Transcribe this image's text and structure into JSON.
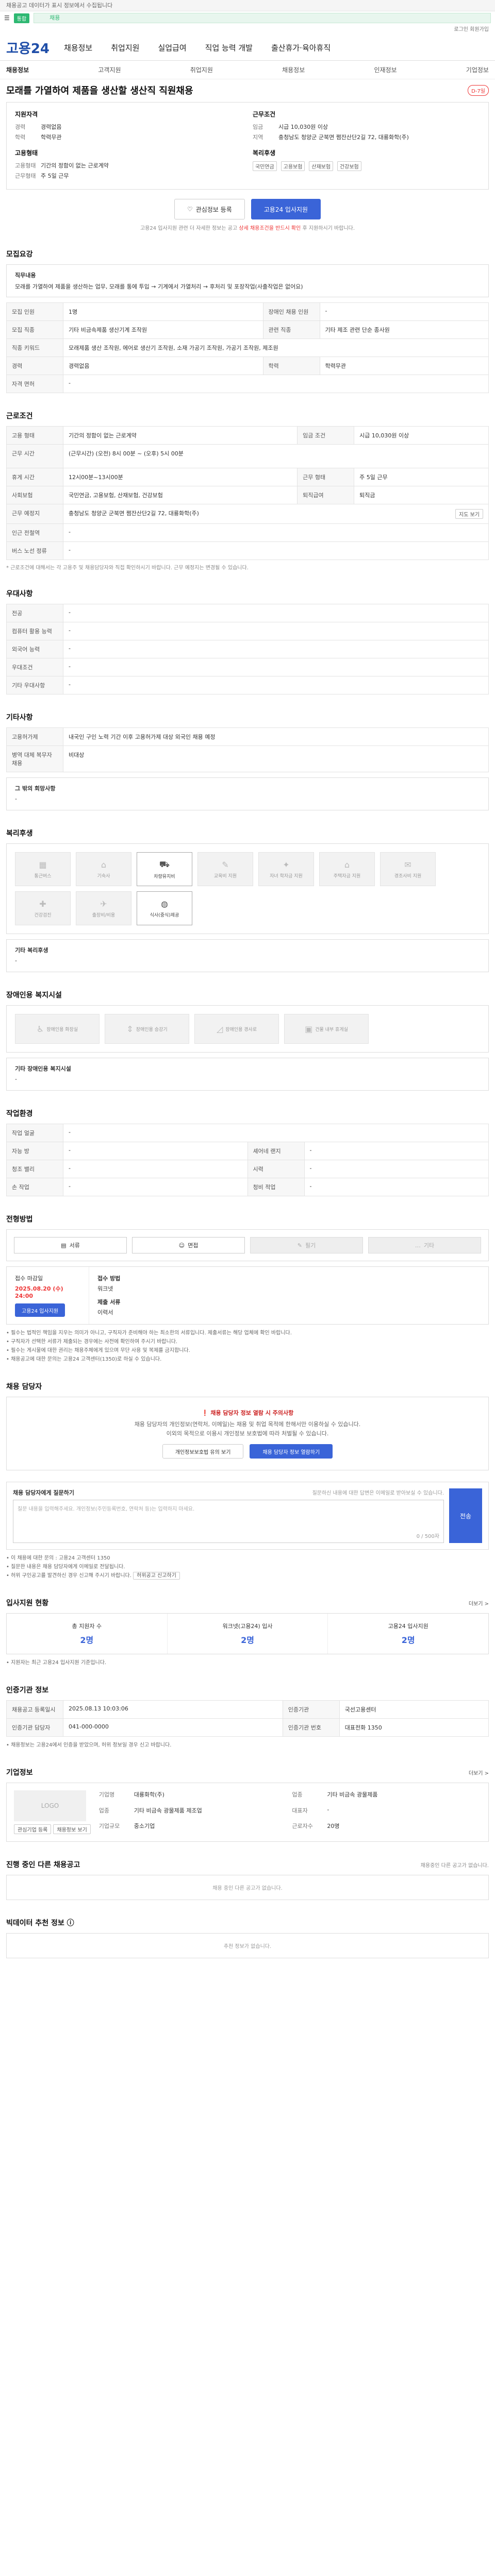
{
  "top_notice": "채용공고 데이터가 표시 정보에서 수집됩니다",
  "search": {
    "tag": "통합",
    "value": "채용"
  },
  "util_links": "로그인  회원가입",
  "logo": "고용24",
  "gnb": [
    "채용정보",
    "취업지원",
    "실업급여",
    "직업 능력 개발",
    "출산휴가·육아휴직"
  ],
  "subnav": [
    "채용정보",
    "고객지원",
    "취업지원",
    "채용정보",
    "인재정보",
    "기업정보"
  ],
  "job": {
    "title": "모래를 가열하여 제품을 생산할 생산직 직원채용",
    "dday": "D-7일",
    "left_head": "지원자격",
    "left": [
      {
        "k": "경력",
        "v": "경력없음"
      },
      {
        "k": "학력",
        "v": "학력무관"
      }
    ],
    "left2_head": "고용형태",
    "left2": [
      {
        "k": "고용형태",
        "v": "기간의 정함이 없는 근로계약"
      },
      {
        "k": "근무형태",
        "v": "주 5일 근무"
      }
    ],
    "right_head": "근무조건",
    "right": [
      {
        "k": "임금",
        "v": "시급 10,030원 이상"
      },
      {
        "k": "지역",
        "v": "충청남도 청양군 군북면 쩜잔산단2길 72, 대룡화학(주)"
      }
    ],
    "right2_head": "복리후생",
    "badges": [
      "국민연금",
      "고용보험",
      "산재보험",
      "건강보험"
    ]
  },
  "actions": {
    "scrap": "관심정보 등록",
    "apply": "고용24 입사지원"
  },
  "apply_note": "고용24 입사지원 관련 더 자세한 정보는 공고",
  "apply_note_red": "상세 채용조건을 반드시 확인",
  "apply_note_tail": "후 지원하시기 바랍니다.",
  "recruit": {
    "title": "모집요강",
    "duty_head": "직무내용",
    "duty": "모래를 가열하여 제품을 생산하는 업무, 모래를 통에 투입 → 기계에서 가열처리 → 후처리 및 포장작업(사출작업은 없어요)",
    "rows": [
      [
        "모집 인원",
        "1명",
        "장애인 채용 인원",
        "-"
      ],
      [
        "모집 직종",
        "기타 비금속제품 생산기계 조작원",
        "관련 직종",
        "기타 제조 관련 단순 종사원"
      ],
      [
        "직종 키워드",
        "모래제품 생산 조작원, 에어로 생산기 조작원, 소재 가공기 조작원, 가공기 조작원, 제조원",
        "",
        ""
      ],
      [
        "경력",
        "경력없음",
        "학력",
        "학력무관"
      ],
      [
        "자격 면허",
        "-",
        "",
        ""
      ]
    ]
  },
  "conditions": {
    "title": "근로조건",
    "rows": [
      [
        "고용 형태",
        "기간의 정함이 없는 근로계약",
        "임금 조건",
        "시급 10,030원 이상"
      ],
      [
        "근무 시간",
        "(근무시간) (오전) 8시 00분 ~ (오후) 5시 00분",
        "",
        ""
      ],
      [
        "휴게 시간",
        "12시00분~13시00분",
        "근무 형태",
        "주 5일 근무"
      ],
      [
        "사회보험",
        "국민연금, 고용보험, 산재보험, 건강보험",
        "퇴직급여",
        "퇴직금"
      ],
      [
        "근무 예정지",
        "충청남도 청양군 군북면 쩜잔산단2길 72, 대룡화학(주)",
        "",
        ""
      ],
      [
        "인근 전철역",
        "-",
        "",
        ""
      ],
      [
        "버스 노선 정류",
        "-",
        "",
        ""
      ]
    ],
    "map_btn": "지도 보기",
    "note": "* 근로조건에 대해서는 각 고용주 및 채용담당자와 직접 확인하시기 바랍니다. 근무 예정지는 변경될 수 있습니다."
  },
  "preference": {
    "title": "우대사항",
    "rows": [
      [
        "전공",
        "-"
      ],
      [
        "컴퓨터 활용 능력",
        "-"
      ],
      [
        "외국어 능력",
        "-"
      ],
      [
        "우대조건",
        "-"
      ],
      [
        "기타 우대사항",
        "-"
      ]
    ]
  },
  "other": {
    "title": "기타사항",
    "rows": [
      [
        "고용허가제",
        "내국인 구인 노력 기간 이후 고용허가제 대상 외국인 채용 예정"
      ],
      [
        "병역 대체 복무자 채용",
        "비대상"
      ]
    ],
    "extra_head": "그 밖의 회망사항",
    "extra_val": "-"
  },
  "welfare": {
    "title": "복리후생",
    "items": [
      {
        "label": "통근버스",
        "glyph": "▦",
        "on": false
      },
      {
        "label": "기숙사",
        "glyph": "⌂",
        "on": false
      },
      {
        "label": "차량유지비",
        "glyph": "⛟",
        "on": true
      },
      {
        "label": "교육비 지원",
        "glyph": "✎",
        "on": false
      },
      {
        "label": "자녀 학자금 지원",
        "glyph": "✦",
        "on": false
      },
      {
        "label": "주택자금 지원",
        "glyph": "⌂",
        "on": false
      },
      {
        "label": "경조사비 지원",
        "glyph": "✉",
        "on": false
      },
      {
        "label": "건강검진",
        "glyph": "✚",
        "on": false
      },
      {
        "label": "출장비/비용",
        "glyph": "✈",
        "on": false
      },
      {
        "label": "식사(중식)제공",
        "glyph": "◍",
        "on": true
      }
    ],
    "extra_head": "기타 복리후생",
    "extra_val": "-"
  },
  "disability": {
    "title": "장애인용 복지시설",
    "items": [
      {
        "label": "장애인용 화장실",
        "glyph": "♿"
      },
      {
        "label": "장애인용 승강기",
        "glyph": "⇕"
      },
      {
        "label": "장애인용 경사로",
        "glyph": "◿"
      },
      {
        "label": "건물 내부 휴게실",
        "glyph": "▣"
      }
    ],
    "extra_head": "기타 장애인용 복지시설",
    "extra_val": "-"
  },
  "env": {
    "title": "작업환경",
    "rows": [
      [
        "작업 얼굴",
        "-",
        "",
        ""
      ],
      [
        "자능 방",
        "-",
        "셰어네 랜지",
        "-"
      ],
      [
        "청조 밸리",
        "-",
        "시력",
        "-"
      ],
      [
        "손 작업",
        "-",
        "청비 적업",
        "-"
      ]
    ]
  },
  "method": {
    "title": "전형방법",
    "items": [
      {
        "label": "서류",
        "glyph": "▤",
        "off": false
      },
      {
        "label": "면접",
        "glyph": "☺",
        "off": false
      },
      {
        "label": "필기",
        "glyph": "✎",
        "off": true
      },
      {
        "label": "기타",
        "glyph": "…",
        "off": true
      }
    ]
  },
  "apply": {
    "period_head": "접수 마감일",
    "period": "2025.08.20 (수) 24:00",
    "period_btn": "고용24 입사지원",
    "method_head": "접수 방법",
    "method_val": "워크넷",
    "docs_head": "제출 서류",
    "docs_val": "이력서",
    "bullets": [
      "• 필수는 법적인 책임을 지우는 의미가 아니고, 구직자가 준비해야 하는 최소한의 서류입니다. 제출서류는 해당 업체에 확인 바랍니다.",
      "• 구직자가 선택한 서류가 제출되는 경우에는 사전에 확인하여 주시기 바랍니다.",
      "• 필수는 게시물에 대한 권리는 채용주체에게 있으며 무단 사용 및 복제를 금지합니다.",
      "• 채용공고에 대한 문의는 고용24 고객센터(1350)로 하실 수 있습니다."
    ]
  },
  "manager": {
    "title": "채용 담당자",
    "warn": "채용 담당자 정보 열람 시 주의사항",
    "desc1": "채용 담당자의 개인정보(연락처, 이메일)는 채용 및 취업 목적에 한해서만 이용하실 수 있습니다.",
    "desc2": "이외의 목적으로 이용시 개인정보 보호법에 따라 처벌될 수 있습니다.",
    "btn1": "개인정보보호법 유의 보기",
    "btn2": "채용 담당자 정보 열람하기",
    "q_head": "채용 담당자에게 질문하기",
    "q_hint": "질문하신 내용에 대한 답변은 이메일로 받아보실 수 있습니다.",
    "q_placeholder": "질문 내용을 입력해주세요. 개인정보(주민등록번호, 연락처 등)는 입력하지 마세요.",
    "q_count": "0 / 500자",
    "q_send": "전송",
    "bullets": [
      "• 이 채용에 대한 문의 : 고용24 고객센터 1350",
      "• 질문한 내용은 채용 담당자에게 이메일로 전달됩니다.",
      "• 허위 구인공고를 발견하신 경우 신고해 주시기 바랍니다."
    ],
    "report_btn": "허위공고 신고하기"
  },
  "stats": {
    "title": "입사지원 현황",
    "more": "더보기 >",
    "items": [
      {
        "label": "총 지원자 수",
        "value": "2명"
      },
      {
        "label": "워크넷(고용24) 입사",
        "value": "2명"
      },
      {
        "label": "고용24 입사지원",
        "value": "2명"
      }
    ],
    "note": "• 지원자는 최근 고용24 입사지원 기준입니다."
  },
  "agency": {
    "title": "인증기관 정보",
    "rows": [
      [
        "채용공고 등록일시",
        "2025.08.13 10:03:06",
        "인증기관",
        "국선고용센터"
      ],
      [
        "인증기관 담당자",
        "041-000-0000",
        "인증기관 번호",
        "대표전화 1350"
      ]
    ],
    "note": "• 채용정보는 고용24에서 인증을 받았으며, 허위 정보일 경우 신고 바랍니다."
  },
  "company": {
    "title": "기업정보",
    "more": "더보기 >",
    "logo": "LOGO",
    "info": [
      [
        "기업명",
        "대룡화학(주)",
        "업종",
        "기타 비금속 광물제품"
      ],
      [
        "업종",
        "기타 비금속 광물제품 제조업",
        "대표자",
        "-"
      ],
      [
        "기업규모",
        "중소기업",
        "근로자수",
        "20명"
      ]
    ],
    "btn1": "관심기업 등록",
    "btn2": "채용정보 보기"
  },
  "same_company": {
    "title": "진행 중인 다른 채용공고",
    "note": "채용중인 다른 공고가 없습니다.",
    "empty": "채용 중인 다른 공고가 없습니다."
  },
  "recommend": {
    "title": "빅데이터 추천 정보",
    "empty": "추천 정보가 없습니다."
  }
}
